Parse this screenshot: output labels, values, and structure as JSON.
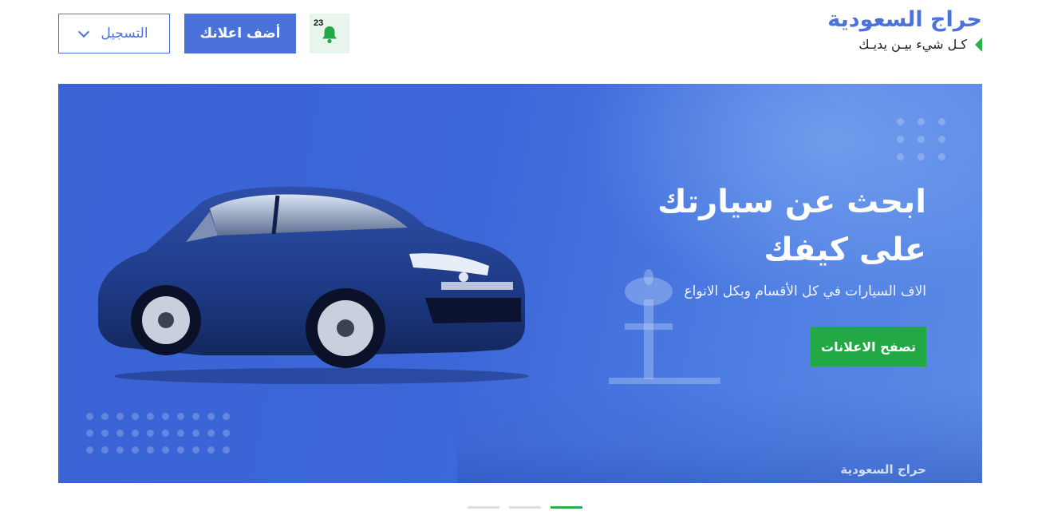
{
  "header": {
    "logo_title": "حراج السعودية",
    "logo_tagline": "كـل شيء بيـن يديـك",
    "notification_count": "23",
    "add_ad_label": "أضف اعلانك",
    "register_label": "التسجيل"
  },
  "hero": {
    "title_line1": "ابحث عن سيارتك",
    "title_line2": "على كيفك",
    "subtitle": "الاف السيارات في كل الأقسام وبكل الانواع",
    "browse_label": "تصفح الاعلانات",
    "brand_watermark": "حراج السعودية"
  },
  "carousel": {
    "slide_count": 3,
    "active_index": 2
  },
  "colors": {
    "brand_blue": "#4a72d9",
    "accent_green": "#22a845",
    "notif_bg": "#e8f5ec"
  },
  "icons": {
    "notification": "bell-icon",
    "register_dropdown": "chevron-down-icon",
    "tagline_marker": "triangle-left-icon"
  }
}
